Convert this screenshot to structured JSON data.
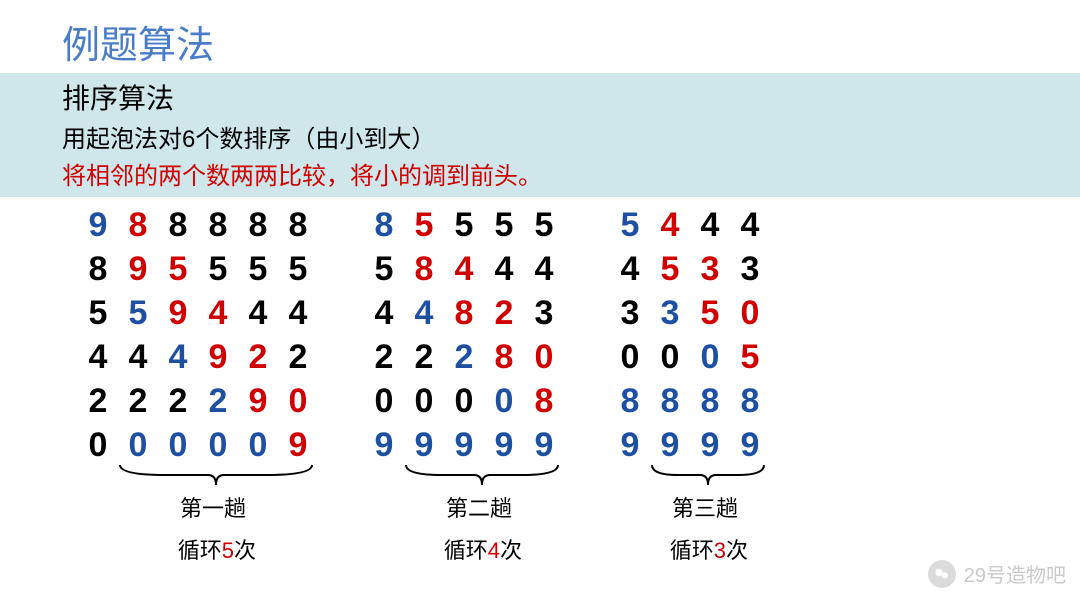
{
  "title": "例题算法",
  "subtitle": "排序算法",
  "desc": "用起泡法对6个数排序（由小到大）",
  "rule": "将相邻的两个数两两比较，将小的调到前头。",
  "watermark": "29号造物吧",
  "passes": [
    {
      "pass_label": "第一趟",
      "loop_prefix": "循环",
      "loop_n": "5",
      "loop_suffix": "次",
      "cols": [
        [
          {
            "v": "9",
            "c": "blue"
          },
          {
            "v": "8",
            "c": "black"
          },
          {
            "v": "5",
            "c": "black"
          },
          {
            "v": "4",
            "c": "black"
          },
          {
            "v": "2",
            "c": "black"
          },
          {
            "v": "0",
            "c": "black"
          }
        ],
        [
          {
            "v": "8",
            "c": "red"
          },
          {
            "v": "9",
            "c": "red"
          },
          {
            "v": "5",
            "c": "blue"
          },
          {
            "v": "4",
            "c": "black"
          },
          {
            "v": "2",
            "c": "black"
          },
          {
            "v": "0",
            "c": "blue"
          }
        ],
        [
          {
            "v": "8",
            "c": "black"
          },
          {
            "v": "5",
            "c": "red"
          },
          {
            "v": "9",
            "c": "red"
          },
          {
            "v": "4",
            "c": "blue"
          },
          {
            "v": "2",
            "c": "black"
          },
          {
            "v": "0",
            "c": "blue"
          }
        ],
        [
          {
            "v": "8",
            "c": "black"
          },
          {
            "v": "5",
            "c": "black"
          },
          {
            "v": "4",
            "c": "red"
          },
          {
            "v": "9",
            "c": "red"
          },
          {
            "v": "2",
            "c": "blue"
          },
          {
            "v": "0",
            "c": "blue"
          }
        ],
        [
          {
            "v": "8",
            "c": "black"
          },
          {
            "v": "5",
            "c": "black"
          },
          {
            "v": "4",
            "c": "black"
          },
          {
            "v": "2",
            "c": "red"
          },
          {
            "v": "9",
            "c": "red"
          },
          {
            "v": "0",
            "c": "blue"
          }
        ],
        [
          {
            "v": "8",
            "c": "black"
          },
          {
            "v": "5",
            "c": "black"
          },
          {
            "v": "4",
            "c": "black"
          },
          {
            "v": "2",
            "c": "black"
          },
          {
            "v": "0",
            "c": "red"
          },
          {
            "v": "9",
            "c": "red"
          }
        ]
      ]
    },
    {
      "pass_label": "第二趟",
      "loop_prefix": "循环",
      "loop_n": "4",
      "loop_suffix": "次",
      "cols": [
        [
          {
            "v": "8",
            "c": "blue"
          },
          {
            "v": "5",
            "c": "black"
          },
          {
            "v": "4",
            "c": "black"
          },
          {
            "v": "2",
            "c": "black"
          },
          {
            "v": "0",
            "c": "black"
          },
          {
            "v": "9",
            "c": "blue"
          }
        ],
        [
          {
            "v": "5",
            "c": "red"
          },
          {
            "v": "8",
            "c": "red"
          },
          {
            "v": "4",
            "c": "blue"
          },
          {
            "v": "2",
            "c": "black"
          },
          {
            "v": "0",
            "c": "black"
          },
          {
            "v": "9",
            "c": "blue"
          }
        ],
        [
          {
            "v": "5",
            "c": "black"
          },
          {
            "v": "4",
            "c": "red"
          },
          {
            "v": "8",
            "c": "red"
          },
          {
            "v": "2",
            "c": "blue"
          },
          {
            "v": "0",
            "c": "black"
          },
          {
            "v": "9",
            "c": "blue"
          }
        ],
        [
          {
            "v": "5",
            "c": "black"
          },
          {
            "v": "4",
            "c": "black"
          },
          {
            "v": "2",
            "c": "red"
          },
          {
            "v": "8",
            "c": "red"
          },
          {
            "v": "0",
            "c": "blue"
          },
          {
            "v": "9",
            "c": "blue"
          }
        ],
        [
          {
            "v": "5",
            "c": "black"
          },
          {
            "v": "4",
            "c": "black"
          },
          {
            "v": "3",
            "c": "black"
          },
          {
            "v": "0",
            "c": "red"
          },
          {
            "v": "8",
            "c": "red"
          },
          {
            "v": "9",
            "c": "blue"
          }
        ]
      ]
    },
    {
      "pass_label": "第三趟",
      "loop_prefix": "循环",
      "loop_n": "3",
      "loop_suffix": "次",
      "cols": [
        [
          {
            "v": "5",
            "c": "blue"
          },
          {
            "v": "4",
            "c": "black"
          },
          {
            "v": "3",
            "c": "black"
          },
          {
            "v": "0",
            "c": "black"
          },
          {
            "v": "8",
            "c": "blue"
          },
          {
            "v": "9",
            "c": "blue"
          }
        ],
        [
          {
            "v": "4",
            "c": "red"
          },
          {
            "v": "5",
            "c": "red"
          },
          {
            "v": "3",
            "c": "blue"
          },
          {
            "v": "0",
            "c": "black"
          },
          {
            "v": "8",
            "c": "blue"
          },
          {
            "v": "9",
            "c": "blue"
          }
        ],
        [
          {
            "v": "4",
            "c": "black"
          },
          {
            "v": "3",
            "c": "red"
          },
          {
            "v": "5",
            "c": "red"
          },
          {
            "v": "0",
            "c": "blue"
          },
          {
            "v": "8",
            "c": "blue"
          },
          {
            "v": "9",
            "c": "blue"
          }
        ],
        [
          {
            "v": "4",
            "c": "black"
          },
          {
            "v": "3",
            "c": "black"
          },
          {
            "v": "0",
            "c": "red"
          },
          {
            "v": "5",
            "c": "red"
          },
          {
            "v": "8",
            "c": "blue"
          },
          {
            "v": "9",
            "c": "blue"
          }
        ]
      ]
    }
  ]
}
